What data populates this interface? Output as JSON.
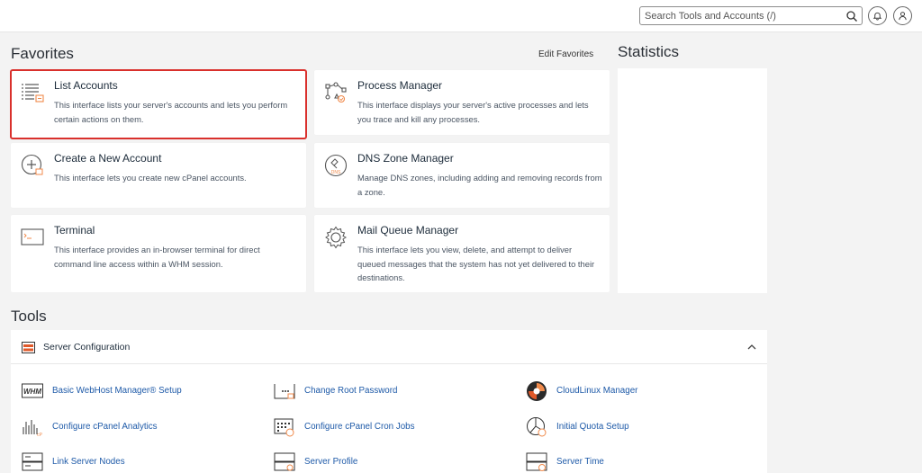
{
  "header": {
    "search_placeholder": "Search Tools and Accounts (/)",
    "icons": [
      "search-icon",
      "bell-icon",
      "user-icon"
    ]
  },
  "favorites": {
    "title": "Favorites",
    "edit_label": "Edit Favorites",
    "cards": [
      {
        "title": "List Accounts",
        "desc": "This interface lists your server's accounts and lets you perform certain actions on them.",
        "icon": "list-accounts-icon",
        "highlighted": true
      },
      {
        "title": "Process Manager",
        "desc": "This interface displays your server's active processes and lets you trace and kill any processes.",
        "icon": "process-manager-icon"
      },
      {
        "title": "Create a New Account",
        "desc": "This interface lets you create new cPanel accounts.",
        "icon": "create-account-icon"
      },
      {
        "title": "DNS Zone Manager",
        "desc": "Manage DNS zones, including adding and removing records from a zone.",
        "icon": "dns-icon"
      },
      {
        "title": "Terminal",
        "desc": "This interface provides an in-browser terminal for direct command line access within a WHM session.",
        "icon": "terminal-icon"
      },
      {
        "title": "Mail Queue Manager",
        "desc": "This interface lets you view, delete, and attempt to deliver queued messages that the system has not yet delivered to their destinations.",
        "icon": "gear-icon"
      }
    ]
  },
  "statistics": {
    "title": "Statistics"
  },
  "tools": {
    "title": "Tools",
    "group_title": "Server Configuration",
    "items": [
      {
        "label": "Basic WebHost Manager® Setup",
        "icon": "whm-icon"
      },
      {
        "label": "Change Root Password",
        "icon": "password-icon"
      },
      {
        "label": "CloudLinux Manager",
        "icon": "cloudlinux-icon"
      },
      {
        "label": "Configure cPanel Analytics",
        "icon": "analytics-icon"
      },
      {
        "label": "Configure cPanel Cron Jobs",
        "icon": "cron-icon"
      },
      {
        "label": "Initial Quota Setup",
        "icon": "quota-icon"
      },
      {
        "label": "Link Server Nodes",
        "icon": "server-nodes-icon"
      },
      {
        "label": "Server Profile",
        "icon": "server-profile-icon"
      },
      {
        "label": "Server Time",
        "icon": "server-time-icon"
      }
    ]
  },
  "colors": {
    "accent": "#1e5aa8",
    "highlight": "#d9302c",
    "orange": "#f08a4b"
  }
}
